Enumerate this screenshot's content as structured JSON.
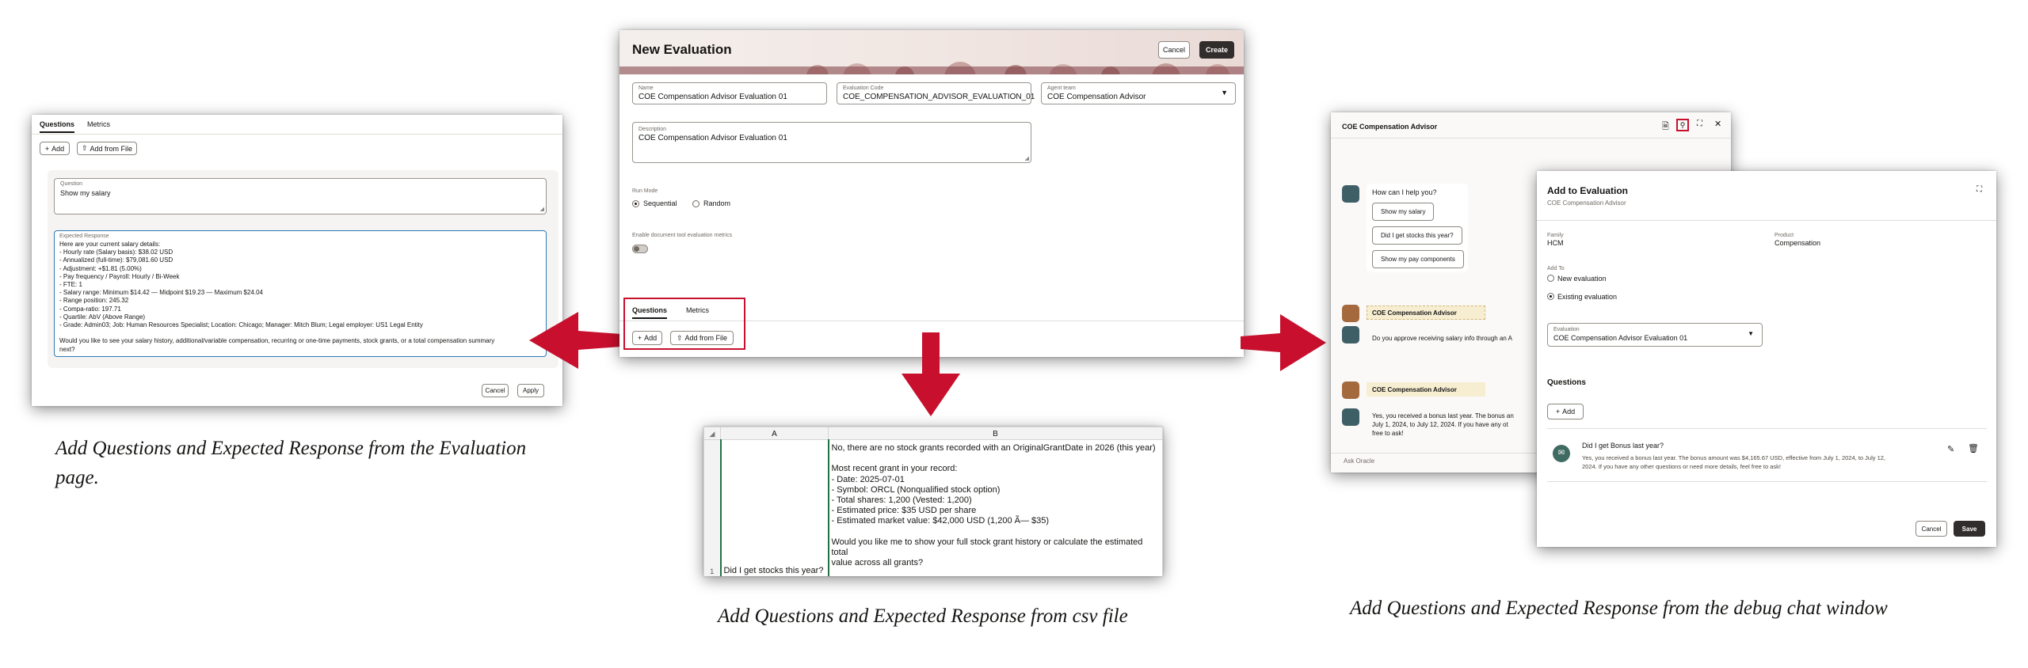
{
  "captions": {
    "left": "Add Questions and Expected Response from the Evaluation page.",
    "middle": "Add Questions and Expected Response from csv file",
    "right": "Add Questions and Expected Response from the debug chat window"
  },
  "left_panel": {
    "tabs": [
      "Questions",
      "Metrics"
    ],
    "add_label": "Add",
    "add_from_file_label": "Add from File",
    "question_label": "Question",
    "question_value": "Show my salary",
    "expected_label": "Expected Response",
    "expected_lines": [
      "Here are your current salary details:",
      "- Hourly rate (Salary basis): $38.02 USD",
      "- Annualized (full-time): $79,081.60 USD",
      "- Adjustment: +$1.81 (5.00%)",
      "- Pay frequency / Payroll: Hourly / Bi-Week",
      "- FTE: 1",
      "- Salary range: Minimum $14.42 — Midpoint $19.23 — Maximum $24.04",
      "- Range position: 245.32",
      "- Compa-ratio: 197.71",
      "- Quartile: AbV (Above Range)",
      "- Grade: Admin03; Job: Human Resources Specialist; Location: Chicago; Manager: Mitch Blum; Legal employer: US1 Legal Entity",
      "",
      "Would you like to see your salary history, additional/variable compensation, recurring or one-time payments, stock grants, or a total compensation summary",
      "next?"
    ],
    "cancel_label": "Cancel",
    "apply_label": "Apply"
  },
  "center_panel": {
    "title": "New Evaluation",
    "cancel_label": "Cancel",
    "create_label": "Create",
    "name_label": "Name",
    "name_value": "COE Compensation Advisor Evaluation 01",
    "code_label": "Evaluation Code",
    "code_value": "COE_COMPENSATION_ADVISOR_EVALUATION_01",
    "team_label": "Agent team",
    "team_value": "COE Compensation Advisor",
    "description_label": "Description",
    "description_value": "COE Compensation Advisor Evaluation 01",
    "run_mode_label": "Run Mode",
    "run_mode_options": [
      "Sequential",
      "Random"
    ],
    "run_mode_selected": "Sequential",
    "metrics_toggle_label": "Enable document tool evaluation metrics",
    "tabs": [
      "Questions",
      "Metrics"
    ],
    "add_label": "Add",
    "add_from_file_label": "Add from File"
  },
  "csv_panel": {
    "col_a": "A",
    "col_b": "B",
    "row_number": "1",
    "question": "Did I get stocks this year?",
    "response_lines": [
      "No, there are no stock grants recorded with an OriginalGrantDate in 2026 (this year)",
      "",
      "Most recent grant in your record:",
      "- Date: 2025-07-01",
      "- Symbol: ORCL (Nonqualified stock option)",
      "- Total shares: 1,200 (Vested: 1,200)",
      "- Estimated price: $35 USD per share",
      "- Estimated market value: $42,000 USD (1,200 Ã— $35)",
      "",
      "Would you like me to show your full stock grant history or calculate the estimated total",
      "value across all grants?"
    ]
  },
  "chat_panel": {
    "title": "COE Compensation Advisor",
    "greeting": "How can I help you?",
    "suggestions": [
      "Show my salary",
      "Did I get stocks this year?",
      "Show my pay components"
    ],
    "agent_name": "COE Compensation Advisor",
    "consent_text": "Do you approve receiving salary info through an A",
    "bonus_text_lines": [
      "Yes, you received a bonus last year. The bonus an",
      "July 1, 2024, to July 12, 2024. If you have any ot",
      "free to ask!"
    ],
    "input_placeholder": "Ask Oracle"
  },
  "add_dialog": {
    "title": "Add to Evaluation",
    "subtitle": "COE Compensation Advisor",
    "family_label": "Family",
    "family_value": "HCM",
    "product_label": "Product",
    "product_value": "Compensation",
    "add_to_label": "Add To",
    "options": [
      "New evaluation",
      "Existing evaluation"
    ],
    "selected_option": "Existing evaluation",
    "evaluation_label": "Evaluation",
    "evaluation_value": "COE Compensation Advisor Evaluation 01",
    "questions_heading": "Questions",
    "add_label": "Add",
    "question_title": "Did I get Bonus last year?",
    "question_answer_lines": [
      "Yes, you received a bonus last year. The bonus amount was $4,165.67 USD, effective from July 1, 2024, to July 12,",
      "2024. If you have any other questions or need more details, feel free to ask!"
    ],
    "cancel_label": "Cancel",
    "save_label": "Save"
  },
  "colors": {
    "arrow": "#c8102e",
    "highlight": "#c8102e",
    "primary_button": "#312d2a",
    "banner_top": "#6b2d35",
    "avatar_teal": "#3f5f67",
    "avatar_brown": "#a46a3e"
  }
}
